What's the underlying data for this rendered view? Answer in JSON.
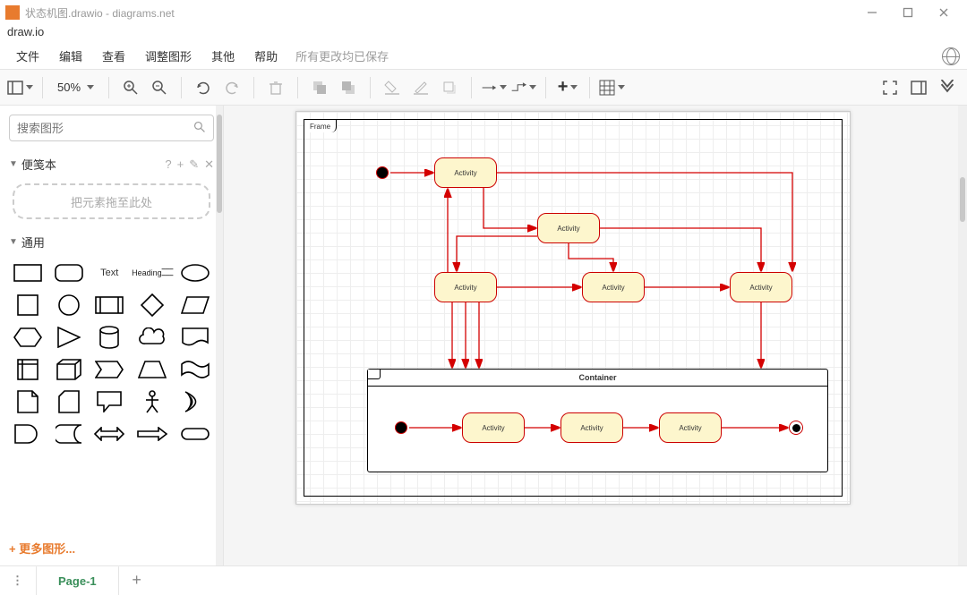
{
  "titlebar": {
    "title": "状态机图.drawio - diagrams.net"
  },
  "subtitle": "draw.io",
  "menu": {
    "file": "文件",
    "edit": "编辑",
    "view": "查看",
    "adjust": "调整图形",
    "other": "其他",
    "help": "帮助",
    "save_status": "所有更改均已保存"
  },
  "toolbar": {
    "zoom": "50%"
  },
  "sidebar": {
    "search_placeholder": "搜索图形",
    "scratchpad": "便笺本",
    "scratch_drop": "把元素拖至此处",
    "general": "通用",
    "text_label": "Text",
    "heading_label": "Heading",
    "more_shapes": "更多图形..."
  },
  "diagram": {
    "frame_label": "Frame",
    "container_label": "Container",
    "activities": {
      "a1": "Activity",
      "a2": "Activity",
      "a3": "Activity",
      "a4": "Activity",
      "a5": "Activity",
      "c1": "Activity",
      "c2": "Activity",
      "c3": "Activity"
    }
  },
  "pagebar": {
    "page1": "Page-1"
  }
}
